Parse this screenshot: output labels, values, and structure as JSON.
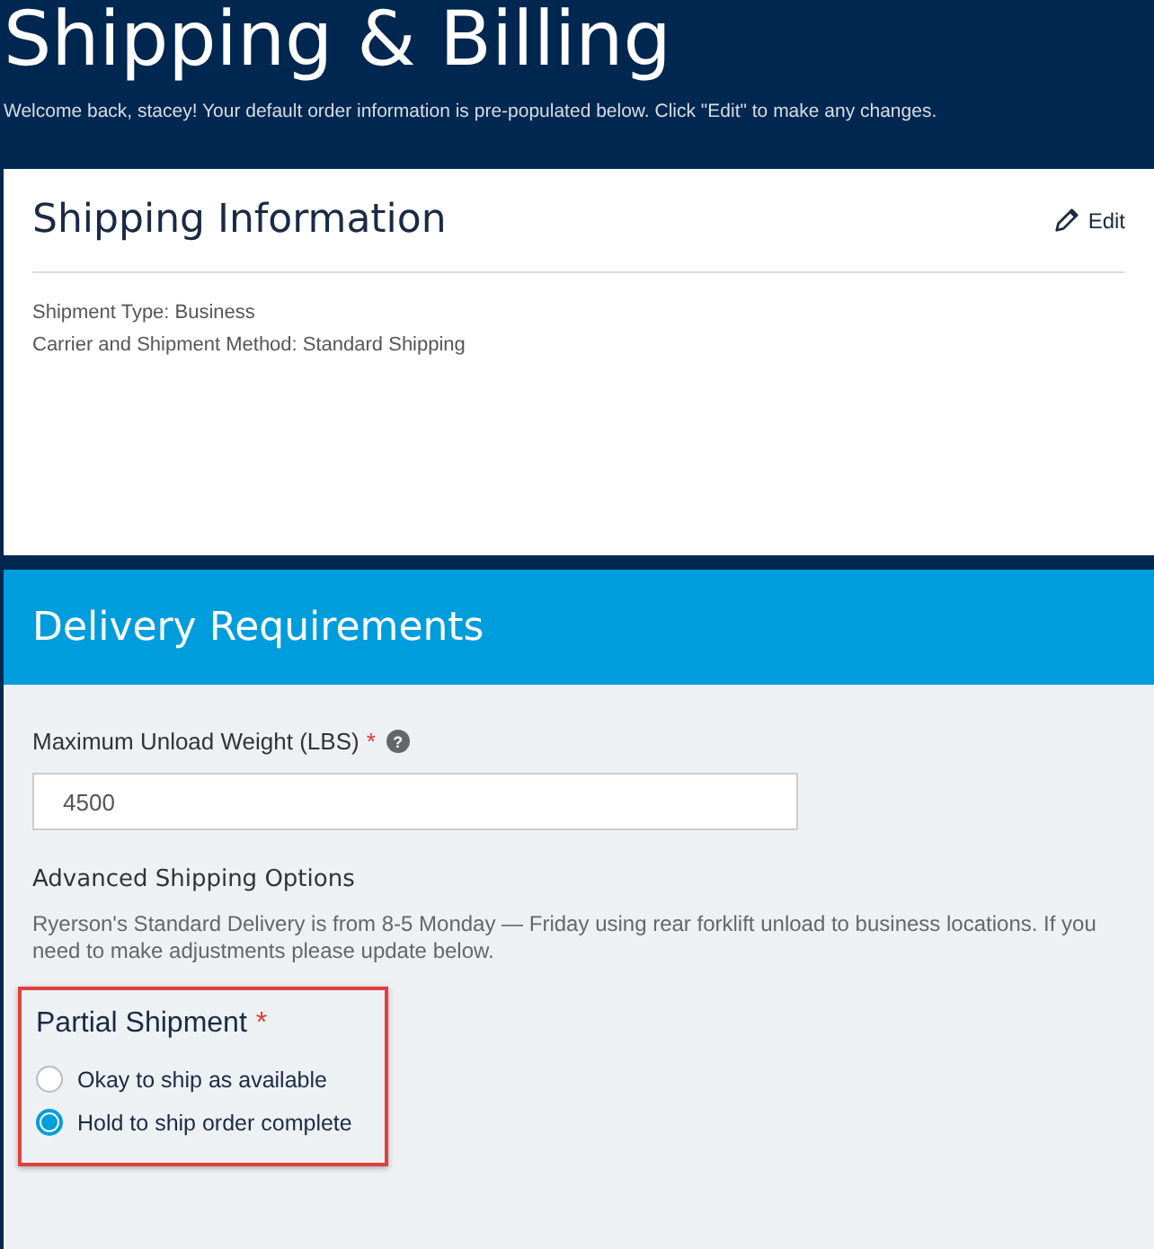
{
  "page": {
    "title": "Shipping & Billing",
    "intro": "Welcome back, stacey! Your default order information is pre-populated below. Click \"Edit\" to make any changes."
  },
  "shipping_information": {
    "title": "Shipping Information",
    "edit_label": "Edit",
    "details": [
      "Shipment Type: Business",
      "Carrier and Shipment Method: Standard Shipping"
    ]
  },
  "delivery_requirements": {
    "title": "Delivery Requirements",
    "weight_field": {
      "label": "Maximum Unload Weight (LBS)",
      "required_mark": "*",
      "help": "?",
      "value": "4500"
    },
    "advanced_title": "Advanced Shipping Options",
    "advanced_text": "Ryerson's Standard Delivery is from 8-5 Monday — Friday using rear forklift unload to business locations. If you need to make adjustments please update below.",
    "partial_shipment": {
      "label": "Partial Shipment",
      "required_mark": "*",
      "highlighted": true,
      "options": [
        {
          "label": "Okay to ship as available",
          "selected": false
        },
        {
          "label": "Hold to ship order complete",
          "selected": true
        }
      ]
    }
  }
}
